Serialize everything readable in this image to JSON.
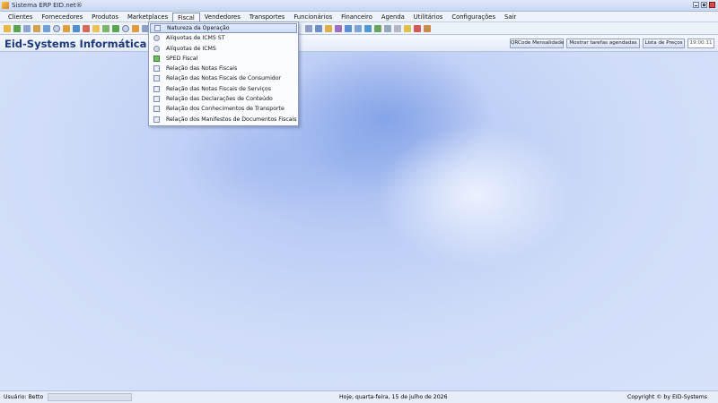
{
  "window": {
    "title": "Sistema ERP EID.net®"
  },
  "menu": [
    {
      "label": "Clientes"
    },
    {
      "label": "Fornecedores"
    },
    {
      "label": "Produtos"
    },
    {
      "label": "Marketplaces"
    },
    {
      "label": "Fiscal"
    },
    {
      "label": "Vendedores"
    },
    {
      "label": "Transportes"
    },
    {
      "label": "Funcionários"
    },
    {
      "label": "Financeiro"
    },
    {
      "label": "Agenda"
    },
    {
      "label": "Utilitários"
    },
    {
      "label": "Configurações"
    },
    {
      "label": "Sair"
    }
  ],
  "active_menu": "Fiscal",
  "fiscal_menu": {
    "items": [
      {
        "label": "Natureza da Operação",
        "icon": "document-icon"
      },
      {
        "label": "Alíquotas de ICMS ST",
        "icon": "coins-icon"
      },
      {
        "label": "Alíquotas de ICMS",
        "icon": "coins-icon"
      },
      {
        "label": "SPED Fiscal",
        "icon": "spreadsheet-icon"
      },
      {
        "label": "Relação das Notas Fiscais",
        "icon": "report-icon"
      },
      {
        "label": "Relação das Notas Fiscais de Consumidor",
        "icon": "report-icon"
      },
      {
        "label": "Relação das Notas Fiscais de Serviços",
        "icon": "report-icon"
      },
      {
        "label": "Relação das Declarações de Conteúdo",
        "icon": "report-icon"
      },
      {
        "label": "Relação dos Conhecimentos de Transporte",
        "icon": "report-icon"
      },
      {
        "label": "Relação dos Manifestos de Documentos Fiscais",
        "icon": "report-icon"
      }
    ],
    "highlighted_index": 0
  },
  "header": {
    "company": "Eid-Systems Informática",
    "buttons": [
      {
        "label": "QRCode Mensalidade"
      },
      {
        "label": "Mostrar tarefas agendadas"
      },
      {
        "label": "Lista de Preços"
      }
    ],
    "clock": "19:00:11"
  },
  "status": {
    "user": "Usuário: Betto",
    "date": "Hoje, quarta-feira, 15 de julho de 2026",
    "copyright": "Copyright © by EID-Systems"
  },
  "colors": {
    "company_text": "#1b3a7a",
    "desktop_bg": "#cfdcf6",
    "menu_highlight": "#cddbf6"
  }
}
